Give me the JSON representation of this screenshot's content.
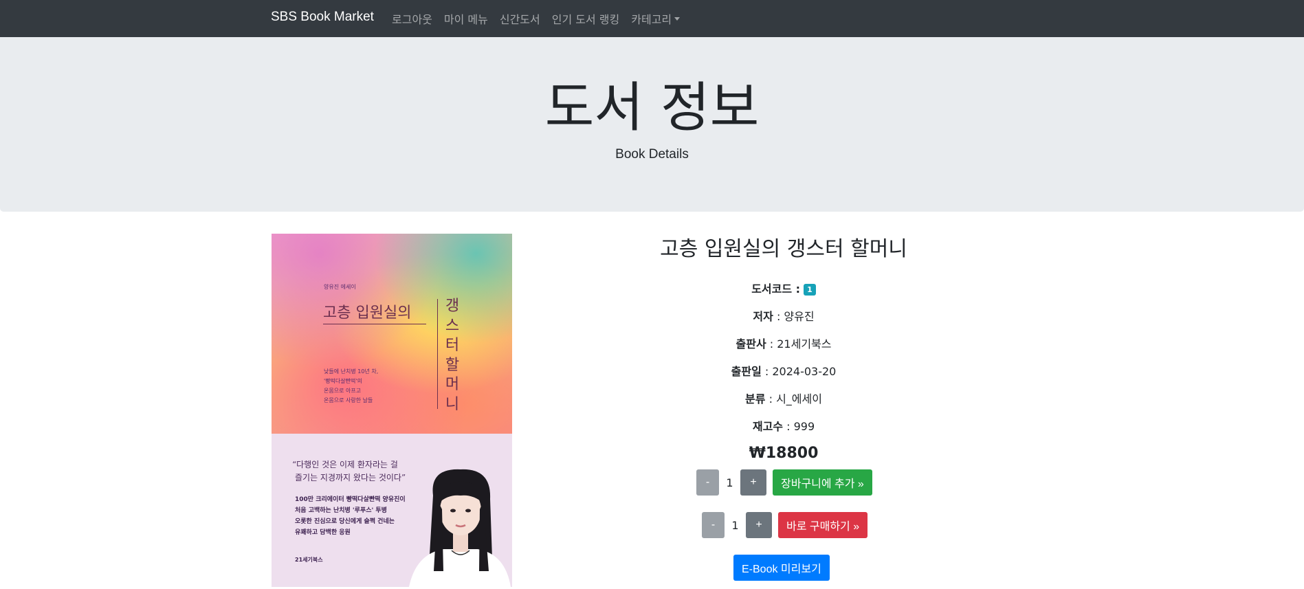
{
  "navbar": {
    "brand": "SBS Book Market",
    "links": [
      "로그아웃",
      "마이 메뉴",
      "신간도서",
      "인기 도서 랭킹",
      "카테고리"
    ]
  },
  "jumbotron": {
    "title": "도서 정보",
    "subtitle": "Book Details"
  },
  "cover": {
    "author_tag": "양유진 에세이",
    "title_horizontal": "고층 입원실의",
    "title_vertical": "갱스터할머니",
    "blurb_lines": [
      "낮들에 난치병 10년 차,",
      "'빵떡다살빤떡'의",
      "온몸으로 아프고",
      "온몸으로 사랑한 날들"
    ],
    "quote_lines": [
      "“다행인 것은 이제 환자라는 걸",
      "즐기는 지경까지 왔다는 것이다”"
    ],
    "body_lines": [
      "100만 크리에이터 빵떡다살빤떡 양유진이",
      "처음 고백하는 난치병 '루푸스' 투병",
      "오롯한 진심으로 당신에게 슬쩍 건네는",
      "유쾌하고 담백한 응원"
    ],
    "publisher_logo": "21세기북스"
  },
  "book": {
    "title": "고층 입원실의 갱스터 할머니",
    "code_label": "도서코드 :",
    "code": "1",
    "author_label": "저자",
    "author": " : 양유진",
    "publisher_label": "출판사",
    "publisher": " : 21세기북스",
    "date_label": "출판일",
    "date": " : 2024-03-20",
    "category_label": "분류",
    "category": " : 시_에세이",
    "stock_label": "재고수",
    "stock": " : 999",
    "price": "₩18800"
  },
  "cart": {
    "minus": "-",
    "qty": "1",
    "plus": "+",
    "add_label": "장바구니에 추가 »"
  },
  "buy": {
    "minus": "-",
    "qty": "1",
    "plus": "+",
    "buy_label": "바로 구매하기 »"
  },
  "ebook": {
    "label": "E-Book 미리보기"
  }
}
